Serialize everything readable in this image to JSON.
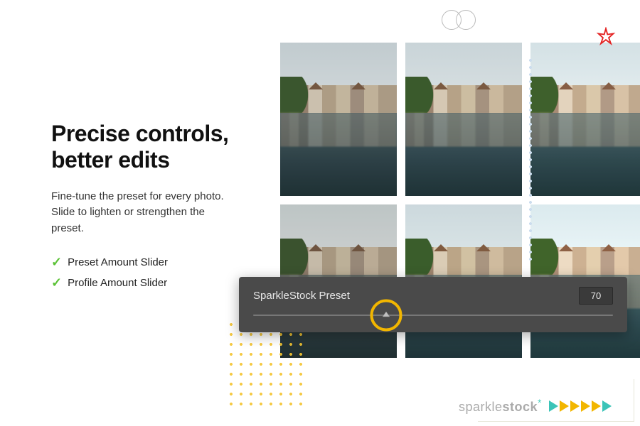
{
  "headline": "Precise controls, better edits",
  "description": "Fine-tune the preset for every photo. Slide to lighten or strengthen the preset.",
  "features": {
    "item1": "Preset Amount Slider",
    "item2": "Profile Amount Slider"
  },
  "slider": {
    "label": "SparkleStock Preset",
    "value": "70"
  },
  "brand": {
    "name_light": "sparkle",
    "name_bold": "stock"
  }
}
